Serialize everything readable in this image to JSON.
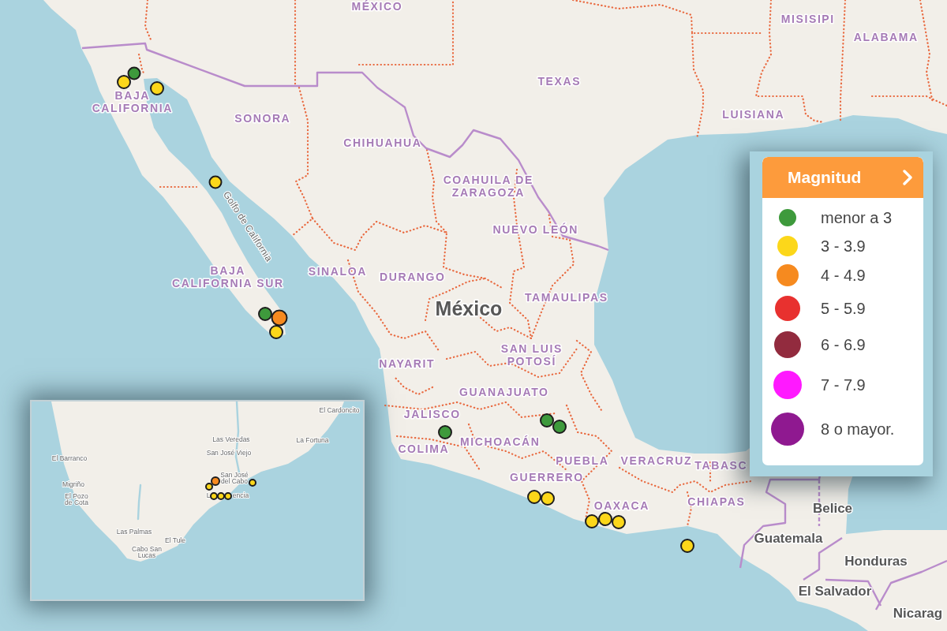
{
  "map": {
    "labels": [
      {
        "kind": "state",
        "lines": [
          "MÉXICO"
        ]
      },
      {
        "kind": "state",
        "lines": [
          "MISISIPI"
        ]
      },
      {
        "kind": "state",
        "lines": [
          "ALABAMA"
        ]
      },
      {
        "kind": "state",
        "lines": [
          "TEXAS"
        ]
      },
      {
        "kind": "state",
        "lines": [
          "BAJA",
          "CALIFORNIA"
        ]
      },
      {
        "kind": "state",
        "lines": [
          "SONORA"
        ]
      },
      {
        "kind": "state",
        "lines": [
          "LUISIANA"
        ]
      },
      {
        "kind": "state",
        "lines": [
          "CHIHUAHUA"
        ]
      },
      {
        "kind": "state",
        "lines": [
          "COAHUILA DE",
          "ZARAGOZA"
        ]
      },
      {
        "kind": "water",
        "lines": [
          "Golfo de California"
        ]
      },
      {
        "kind": "state",
        "lines": [
          "NUEVO LEÓN"
        ]
      },
      {
        "kind": "state",
        "lines": [
          "BAJA",
          "CALIFORNIA SUR"
        ]
      },
      {
        "kind": "state",
        "lines": [
          "SINALOA"
        ]
      },
      {
        "kind": "state",
        "lines": [
          "DURANGO"
        ]
      },
      {
        "kind": "country_large",
        "lines": [
          "México"
        ]
      },
      {
        "kind": "state",
        "lines": [
          "TAMAULIPAS"
        ]
      },
      {
        "kind": "state",
        "lines": [
          "NAYARIT"
        ]
      },
      {
        "kind": "state",
        "lines": [
          "SAN LUIS",
          "POTOSÍ"
        ]
      },
      {
        "kind": "state",
        "lines": [
          "GUANAJUATO"
        ]
      },
      {
        "kind": "state",
        "lines": [
          "JALISCO"
        ]
      },
      {
        "kind": "state",
        "lines": [
          "COLIMA"
        ]
      },
      {
        "kind": "state",
        "lines": [
          "MICHOACÁN"
        ]
      },
      {
        "kind": "state",
        "lines": [
          "PUEBLA"
        ]
      },
      {
        "kind": "state",
        "lines": [
          "VERACRUZ"
        ]
      },
      {
        "kind": "state",
        "lines": [
          "TABASC"
        ]
      },
      {
        "kind": "state",
        "lines": [
          "GUERRERO"
        ]
      },
      {
        "kind": "state",
        "lines": [
          "OAXACA"
        ]
      },
      {
        "kind": "state",
        "lines": [
          "CHIAPAS"
        ]
      },
      {
        "kind": "country",
        "lines": [
          "Belice"
        ]
      },
      {
        "kind": "country",
        "lines": [
          "Guatemala"
        ]
      },
      {
        "kind": "country",
        "lines": [
          "Honduras"
        ]
      },
      {
        "kind": "country",
        "lines": [
          "El Salvador"
        ]
      },
      {
        "kind": "country",
        "lines": [
          "Nicarag"
        ]
      }
    ],
    "markers": [
      {
        "color": "#3e9a3c"
      },
      {
        "color": "#fcd71a"
      },
      {
        "color": "#fcd71a"
      },
      {
        "color": "#fcd71a"
      },
      {
        "color": "#3e9a3c"
      },
      {
        "color": "#fcd71a"
      },
      {
        "color": "#f68a1f"
      },
      {
        "color": "#3e9a3c"
      },
      {
        "color": "#3e9a3c"
      },
      {
        "color": "#3e9a3c"
      },
      {
        "color": "#fcd71a"
      },
      {
        "color": "#fcd71a"
      },
      {
        "color": "#fcd71a"
      },
      {
        "color": "#fcd71a"
      },
      {
        "color": "#fcd71a"
      },
      {
        "color": "#fcd71a"
      }
    ]
  },
  "inset": {
    "labels": [
      {
        "lines": [
          "El Cardoncito"
        ]
      },
      {
        "lines": [
          "Las Veredas"
        ]
      },
      {
        "lines": [
          "La Fortuna"
        ]
      },
      {
        "lines": [
          "El Barranco"
        ]
      },
      {
        "lines": [
          "San José Viejo"
        ]
      },
      {
        "lines": [
          "Migriño"
        ]
      },
      {
        "lines": [
          "San José",
          "del Cabo"
        ]
      },
      {
        "lines": [
          "El Pozo",
          "de Cota"
        ]
      },
      {
        "lines": [
          "L"
        ]
      },
      {
        "lines": [
          "encia"
        ]
      },
      {
        "lines": [
          "Las Palmas"
        ]
      },
      {
        "lines": [
          "El Tule"
        ]
      },
      {
        "lines": [
          "Cabo San",
          "Lucas"
        ]
      }
    ],
    "markers": [
      {
        "color": "#f68a1f"
      },
      {
        "color": "#fcd71a"
      },
      {
        "color": "#fcd71a"
      },
      {
        "color": "#fcd71a"
      },
      {
        "color": "#fcd71a"
      },
      {
        "color": "#fcd71a"
      }
    ]
  },
  "legend": {
    "title": "Magnitud",
    "items": [
      {
        "label": "menor a 3",
        "color": "#3e9a3c"
      },
      {
        "label": "3 - 3.9",
        "color": "#fcd71a"
      },
      {
        "label": "4 - 4.9",
        "color": "#f68a1f"
      },
      {
        "label": "5 - 5.9",
        "color": "#e8312f"
      },
      {
        "label": "6 - 6.9",
        "color": "#922b3e"
      },
      {
        "label": "7 - 7.9",
        "color": "#ff19ff"
      },
      {
        "label": "8 o mayor.",
        "color": "#8f1990"
      }
    ]
  }
}
